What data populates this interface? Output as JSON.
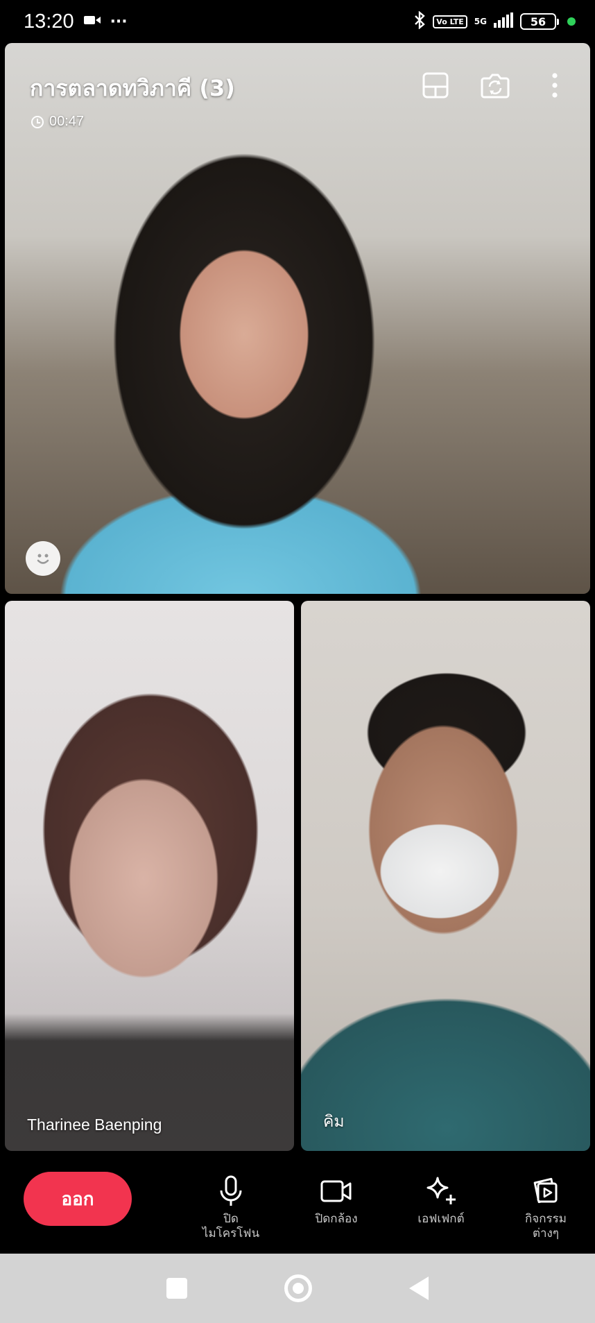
{
  "status_bar": {
    "time": "13:20",
    "more": "···",
    "volte": "Vo LTE",
    "network": "5G",
    "battery": "56"
  },
  "call": {
    "title": "การตลาดทวิภาคี  (3)",
    "timer": "00:47"
  },
  "participants": [
    {
      "name": "Tharinee Baenping"
    },
    {
      "name": "คิม"
    }
  ],
  "toolbar": {
    "leave_label": "ออก",
    "mic_label": "ปิด\nไมโครโฟน",
    "camera_label": "ปิดกล้อง",
    "effects_label": "เอฟเฟกต์",
    "activities_label": "กิจกรรม\nต่างๆ"
  },
  "colors": {
    "leave_button": "#f2344f",
    "status_dot": "#2fd15a",
    "nav_bar": "#d3d3d3"
  },
  "icons": [
    "video-camera-icon",
    "bluetooth-icon",
    "signal-icon",
    "battery-icon",
    "layout-icon",
    "switch-camera-icon",
    "more-vertical-icon",
    "clock-icon",
    "emoji-icon",
    "microphone-icon",
    "camera-icon",
    "sparkle-icon",
    "activities-icon"
  ]
}
